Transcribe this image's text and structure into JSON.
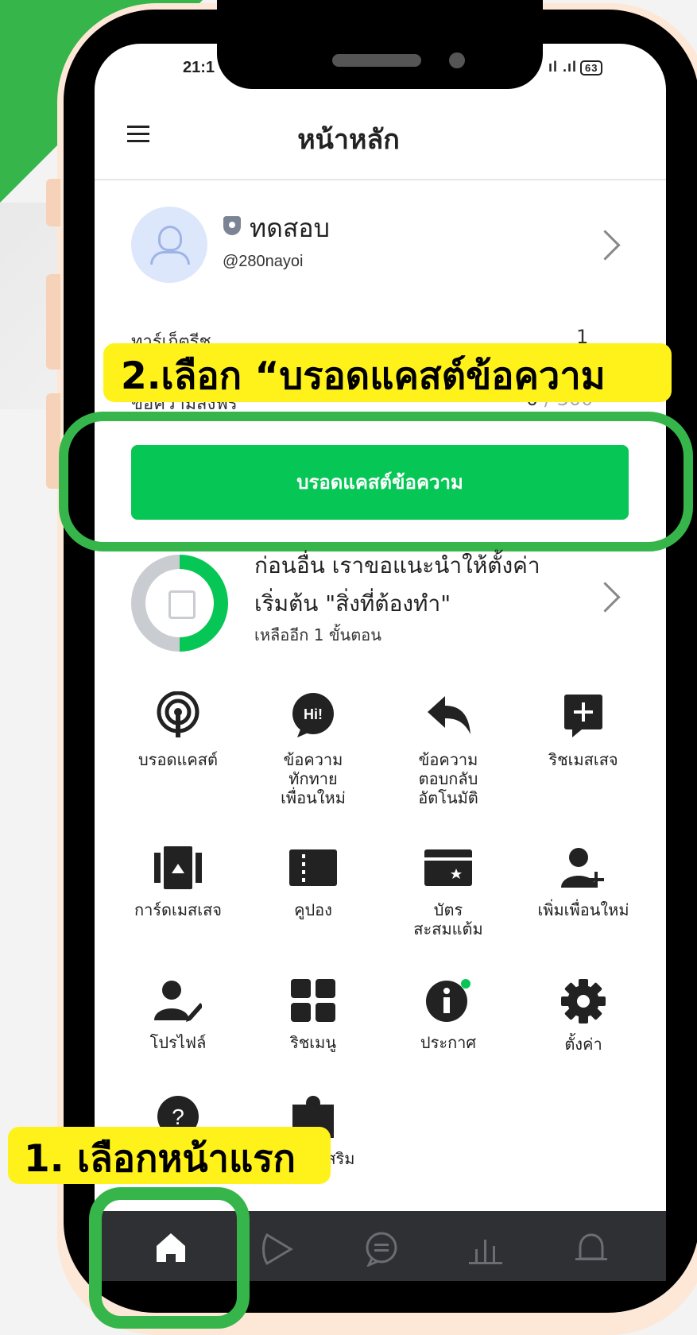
{
  "status_bar": {
    "time": "21:1",
    "signal": "ıl .ıl",
    "battery": "63"
  },
  "header": {
    "title": "หน้าหลัก",
    "menu_icon": "hamburger-icon"
  },
  "account": {
    "name": "ทดสอบ",
    "handle": "@280nayoi",
    "badge_icon": "shield-icon"
  },
  "stats": [
    {
      "label": "ทาร์เก็ตรีช",
      "value": "1"
    },
    {
      "label": "ข้อความส่งฟรี",
      "value": "0",
      "max": " / 300"
    }
  ],
  "callouts": {
    "step2": "2.เลือก “บรอดแคสต์ข้อความ",
    "step1": "1. เลือกหน้าแรก"
  },
  "broadcast_button": {
    "label": "บรอดแคสต์ข้อความ"
  },
  "setup": {
    "line1": "ก่อนอื่น เราขอแนะนำให้ตั้งค่า",
    "line2": "เริ่มต้น \"สิ่งที่ต้องทำ\"",
    "line3": "เหลืออีก 1 ขั้นตอน",
    "progress": 0.5
  },
  "features": [
    {
      "label": "บรอดแคสต์",
      "icon": "broadcast-icon"
    },
    {
      "label": "ข้อความ\nทักทาย\nเพื่อนใหม่",
      "icon": "greeting-hi-icon",
      "icon_text": "Hi!"
    },
    {
      "label": "ข้อความ\nตอบกลับ\nอัตโนมัติ",
      "icon": "reply-icon"
    },
    {
      "label": "ริชเมสเสจ",
      "icon": "rich-message-icon"
    },
    {
      "label": "การ์ดเมสเสจ",
      "icon": "card-message-icon"
    },
    {
      "label": "คูปอง",
      "icon": "coupon-icon"
    },
    {
      "label": "บัตร\nสะสมแต้ม",
      "icon": "reward-card-icon"
    },
    {
      "label": "เพิ่มเพื่อนใหม่",
      "icon": "add-friend-icon"
    },
    {
      "label": "โปรไฟล์",
      "icon": "profile-icon"
    },
    {
      "label": "ริชเมนู",
      "icon": "rich-menu-icon"
    },
    {
      "label": "ประกาศ",
      "icon": "info-icon"
    },
    {
      "label": "ตั้งค่า",
      "icon": "gear-icon"
    },
    {
      "label": "",
      "icon": "help-icon"
    },
    {
      "label": "เสริม",
      "icon": "extension-icon"
    }
  ],
  "bottom_nav": [
    {
      "icon": "home-icon",
      "active": true
    },
    {
      "icon": "play-icon"
    },
    {
      "icon": "chat-icon"
    },
    {
      "icon": "insight-chart-icon"
    },
    {
      "icon": "bell-icon"
    }
  ],
  "colors": {
    "accent_green": "#06c755",
    "callout_yellow": "#fff21a",
    "frame_green": "#36b54a"
  }
}
